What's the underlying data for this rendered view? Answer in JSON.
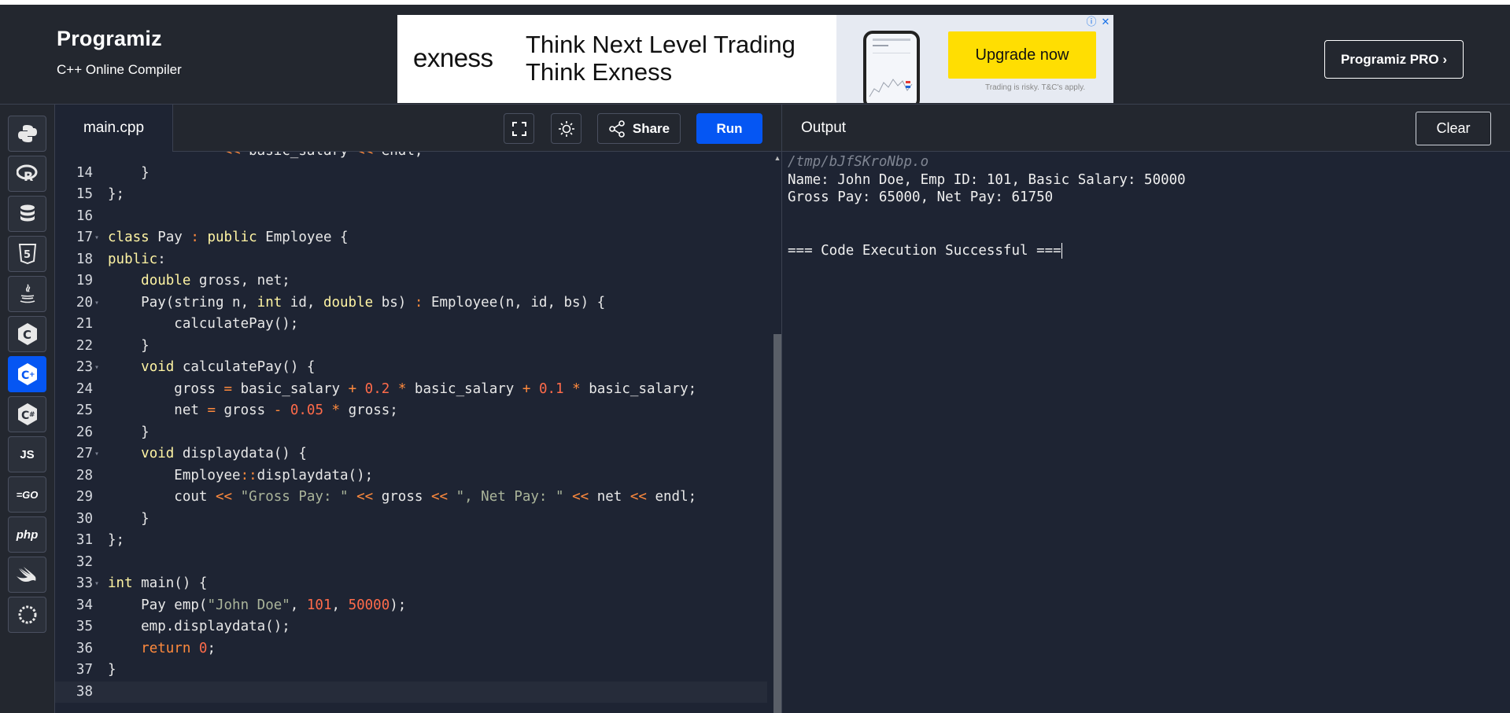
{
  "header": {
    "brand": "Programiz",
    "subtitle": "C++ Online Compiler",
    "pro_button": "Programiz PRO ›"
  },
  "ad": {
    "brand": "exness",
    "line1": "Think Next Level Trading",
    "line2": "Think Exness",
    "cta": "Upgrade now",
    "fine_print": "Trading is risky. T&C's apply.",
    "info_glyph": "ⓘ",
    "close_glyph": "✕"
  },
  "sidebar": {
    "languages": [
      {
        "name": "python",
        "glyph": "🐍"
      },
      {
        "name": "r",
        "glyph": "R"
      },
      {
        "name": "sql",
        "glyph": "≣"
      },
      {
        "name": "html",
        "glyph": "5"
      },
      {
        "name": "java",
        "glyph": "☕"
      },
      {
        "name": "c",
        "glyph": "C"
      },
      {
        "name": "cpp",
        "glyph": "C+"
      },
      {
        "name": "csharp",
        "glyph": "C#"
      },
      {
        "name": "js",
        "glyph": "JS"
      },
      {
        "name": "go",
        "glyph": "GO"
      },
      {
        "name": "php",
        "glyph": "php"
      },
      {
        "name": "swift",
        "glyph": "➹"
      }
    ],
    "active": "cpp"
  },
  "editor": {
    "tab": "main.cpp",
    "share_label": "Share",
    "run_label": "Run",
    "lines": [
      {
        "n": "",
        "tokens": [
          [
            "",
            "            \" "
          ],
          [
            "o",
            "<<"
          ],
          [
            "",
            " basic_salary "
          ],
          [
            "o",
            "<<"
          ],
          [
            "",
            " endl;"
          ]
        ]
      },
      {
        "n": "14",
        "tokens": [
          [
            "",
            "    }"
          ]
        ]
      },
      {
        "n": "15",
        "tokens": [
          [
            "",
            "};"
          ]
        ]
      },
      {
        "n": "16",
        "tokens": [
          [
            "",
            ""
          ]
        ]
      },
      {
        "n": "17",
        "fold": true,
        "tokens": [
          [
            "k",
            "class"
          ],
          [
            "",
            " Pay "
          ],
          [
            "o",
            ":"
          ],
          [
            "",
            " "
          ],
          [
            "k",
            "public"
          ],
          [
            "",
            " Employee {"
          ]
        ]
      },
      {
        "n": "18",
        "tokens": [
          [
            "k",
            "public"
          ],
          [
            "",
            ":"
          ]
        ]
      },
      {
        "n": "19",
        "tokens": [
          [
            "",
            "    "
          ],
          [
            "k",
            "double"
          ],
          [
            "",
            " gross, net;"
          ]
        ]
      },
      {
        "n": "20",
        "fold": true,
        "tokens": [
          [
            "",
            "    Pay(string n, "
          ],
          [
            "k",
            "int"
          ],
          [
            "",
            " id, "
          ],
          [
            "k",
            "double"
          ],
          [
            "",
            " bs) "
          ],
          [
            "o",
            ":"
          ],
          [
            "",
            " Employee(n, id, bs) {"
          ]
        ]
      },
      {
        "n": "21",
        "tokens": [
          [
            "",
            "        calculatePay();"
          ]
        ]
      },
      {
        "n": "22",
        "tokens": [
          [
            "",
            "    }"
          ]
        ]
      },
      {
        "n": "23",
        "fold": true,
        "tokens": [
          [
            "",
            "    "
          ],
          [
            "k",
            "void"
          ],
          [
            "",
            " calculatePay() {"
          ]
        ]
      },
      {
        "n": "24",
        "tokens": [
          [
            "",
            "        gross "
          ],
          [
            "o",
            "="
          ],
          [
            "",
            " basic_salary "
          ],
          [
            "o",
            "+"
          ],
          [
            "",
            " "
          ],
          [
            "n",
            "0.2"
          ],
          [
            "",
            " "
          ],
          [
            "o",
            "*"
          ],
          [
            "",
            " basic_salary "
          ],
          [
            "o",
            "+"
          ],
          [
            "",
            " "
          ],
          [
            "n",
            "0.1"
          ],
          [
            "",
            " "
          ],
          [
            "o",
            "*"
          ],
          [
            "",
            " basic_salary;"
          ]
        ]
      },
      {
        "n": "25",
        "tokens": [
          [
            "",
            "        net "
          ],
          [
            "o",
            "="
          ],
          [
            "",
            " gross "
          ],
          [
            "o",
            "-"
          ],
          [
            "",
            " "
          ],
          [
            "n",
            "0.05"
          ],
          [
            "",
            " "
          ],
          [
            "o",
            "*"
          ],
          [
            "",
            " gross;"
          ]
        ]
      },
      {
        "n": "26",
        "tokens": [
          [
            "",
            "    }"
          ]
        ]
      },
      {
        "n": "27",
        "fold": true,
        "tokens": [
          [
            "",
            "    "
          ],
          [
            "k",
            "void"
          ],
          [
            "",
            " displaydata() {"
          ]
        ]
      },
      {
        "n": "28",
        "tokens": [
          [
            "",
            "        Employee"
          ],
          [
            "o",
            "::"
          ],
          [
            "",
            "displaydata();"
          ]
        ]
      },
      {
        "n": "29",
        "tokens": [
          [
            "",
            "        cout "
          ],
          [
            "o",
            "<<"
          ],
          [
            "",
            " "
          ],
          [
            "s",
            "\"Gross Pay: \""
          ],
          [
            "",
            " "
          ],
          [
            "o",
            "<<"
          ],
          [
            "",
            " gross "
          ],
          [
            "o",
            "<<"
          ],
          [
            "",
            " "
          ],
          [
            "s",
            "\", Net Pay: \""
          ],
          [
            "",
            " "
          ],
          [
            "o",
            "<<"
          ],
          [
            "",
            " net "
          ],
          [
            "o",
            "<<"
          ],
          [
            "",
            " endl;"
          ]
        ]
      },
      {
        "n": "30",
        "tokens": [
          [
            "",
            "    }"
          ]
        ]
      },
      {
        "n": "31",
        "tokens": [
          [
            "",
            "};"
          ]
        ]
      },
      {
        "n": "32",
        "tokens": [
          [
            "",
            ""
          ]
        ]
      },
      {
        "n": "33",
        "fold": true,
        "tokens": [
          [
            "k",
            "int"
          ],
          [
            "",
            " main() {"
          ]
        ]
      },
      {
        "n": "34",
        "tokens": [
          [
            "",
            "    Pay emp("
          ],
          [
            "s",
            "\"John Doe\""
          ],
          [
            "",
            ", "
          ],
          [
            "n",
            "101"
          ],
          [
            "",
            ", "
          ],
          [
            "n",
            "50000"
          ],
          [
            "",
            ");"
          ]
        ]
      },
      {
        "n": "35",
        "tokens": [
          [
            "",
            "    emp.displaydata();"
          ]
        ]
      },
      {
        "n": "36",
        "tokens": [
          [
            "",
            "    "
          ],
          [
            "o",
            "return"
          ],
          [
            "",
            " "
          ],
          [
            "n",
            "0"
          ],
          [
            "",
            ";"
          ]
        ]
      },
      {
        "n": "37",
        "tokens": [
          [
            "",
            "}"
          ]
        ]
      },
      {
        "n": "38",
        "cursor": true,
        "tokens": [
          [
            "",
            ""
          ]
        ]
      }
    ]
  },
  "output": {
    "title": "Output",
    "clear_label": "Clear",
    "path": "/tmp/bJfSKroNbp.o",
    "line1": "Name: John Doe, Emp ID: 101, Basic Salary: 50000",
    "line2": "Gross Pay: 65000, Net Pay: 61750",
    "status": "=== Code Execution Successful ==="
  }
}
